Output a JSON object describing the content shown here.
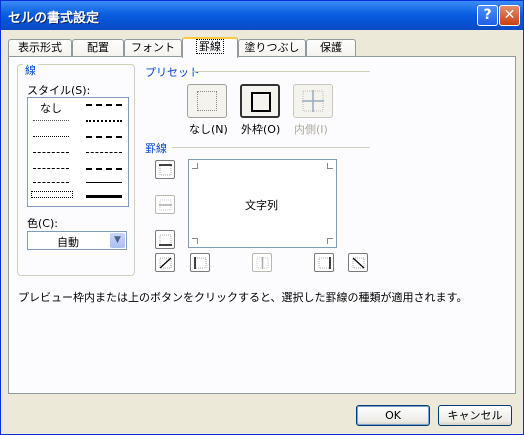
{
  "window": {
    "title": "セルの書式設定"
  },
  "titlebar": {
    "help_icon": "question-mark",
    "close_icon": "x"
  },
  "tabs": [
    {
      "label": "表示形式",
      "active": false
    },
    {
      "label": "配置",
      "active": false
    },
    {
      "label": "フォント",
      "active": false
    },
    {
      "label": "罫線",
      "active": true
    },
    {
      "label": "塗りつぶし",
      "active": false
    },
    {
      "label": "保護",
      "active": false
    }
  ],
  "line_section": {
    "heading": "線",
    "style_label": "スタイル(S):",
    "none_label": "なし",
    "color_label": "色(C):",
    "color_value": "自動"
  },
  "preset_section": {
    "heading": "プリセット",
    "none_label": "なし(N)",
    "outline_label": "外枠(O)",
    "inside_label": "内側(I)"
  },
  "border_section": {
    "heading": "罫線",
    "preview_text": "文字列"
  },
  "status_text": "プレビュー枠内または上のボタンをクリックすると、選択した罫線の種類が適用されます。",
  "buttons": {
    "ok": "OK",
    "cancel": "キャンセル"
  },
  "colors": {
    "titlebar": "#0a5ee0",
    "tab_highlight": "#ffc83c",
    "group_heading": "#0046d5",
    "selection": "#316ac5"
  }
}
